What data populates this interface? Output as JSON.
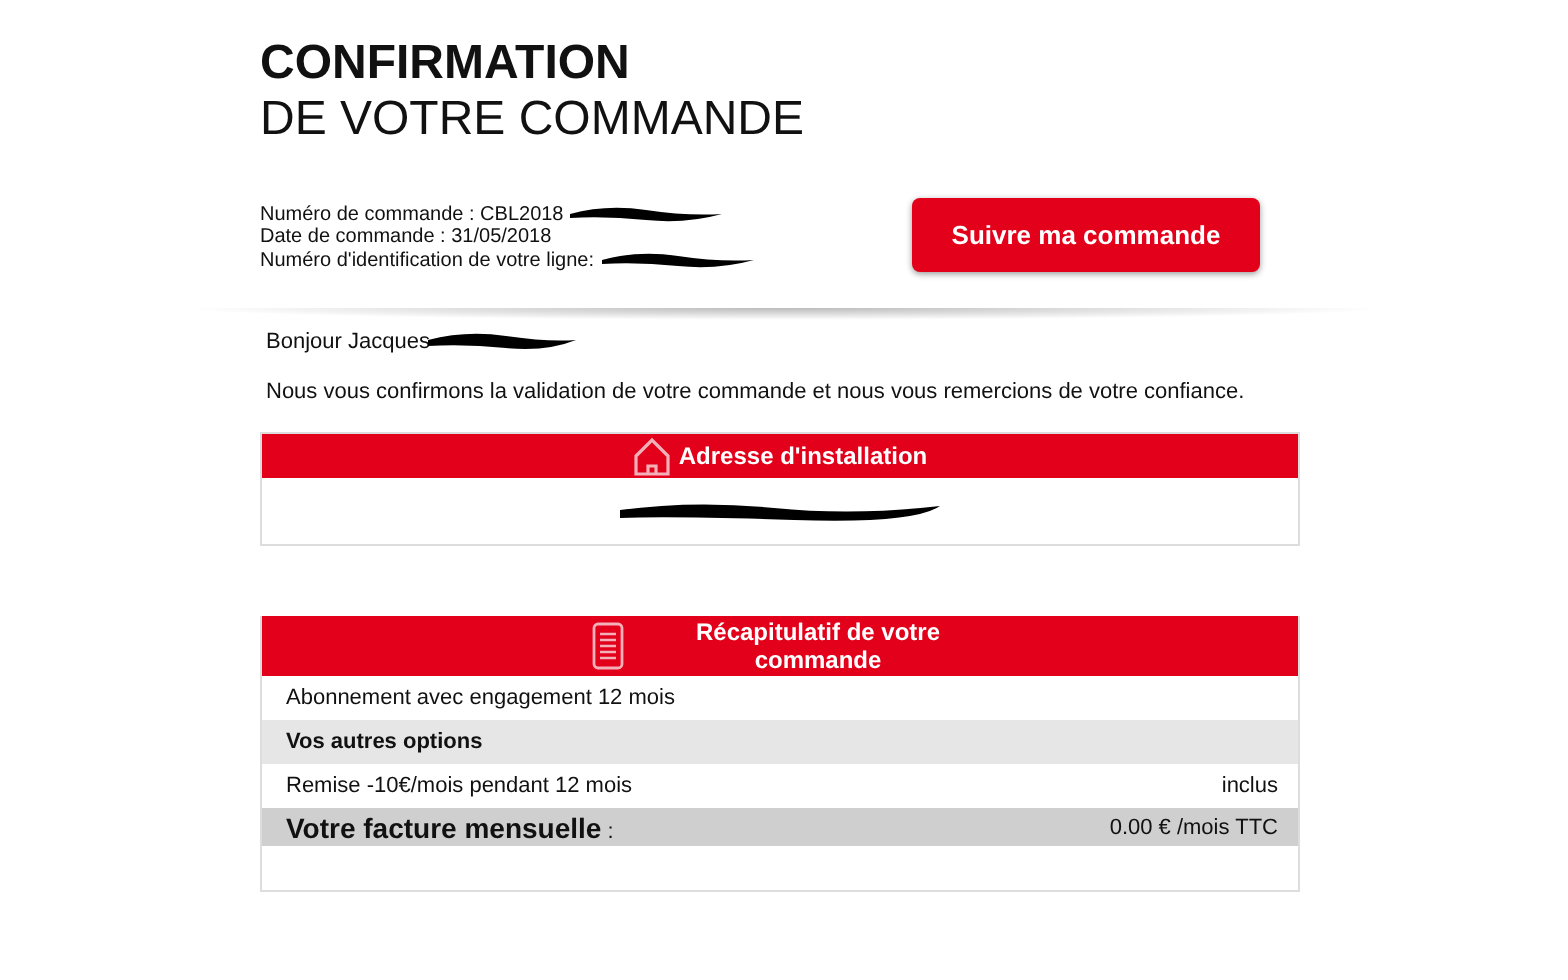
{
  "title": {
    "line_1": "CONFIRMATION",
    "line_2": "DE VOTRE COMMANDE"
  },
  "order_info": [
    "Numéro de commande : CBL2018",
    "Date de commande : 31/05/2018",
    "Numéro d'identification de votre ligne:"
  ],
  "track_button": "Suivre ma commande",
  "greeting": "Bonjour Jacques",
  "message": "Nous vous confirmons la validation de votre commande et nous vous remercions de votre confiance.",
  "address_panel": {
    "title": "Adresse d'installation"
  },
  "summary_panel": {
    "title": "Récapitulatif de votre commande",
    "rows": [
      {
        "kind": "plain",
        "label": "Abonnement avec engagement 12 mois"
      },
      {
        "kind": "section",
        "label": "Vos autres options"
      },
      {
        "kind": "plain",
        "label": "Remise -10€/mois pendant 12 mois",
        "value": "inclus"
      },
      {
        "kind": "total",
        "label": "**Votre facture mensuelle** :",
        "value": "0.00 € /mois TTC"
      }
    ]
  }
}
